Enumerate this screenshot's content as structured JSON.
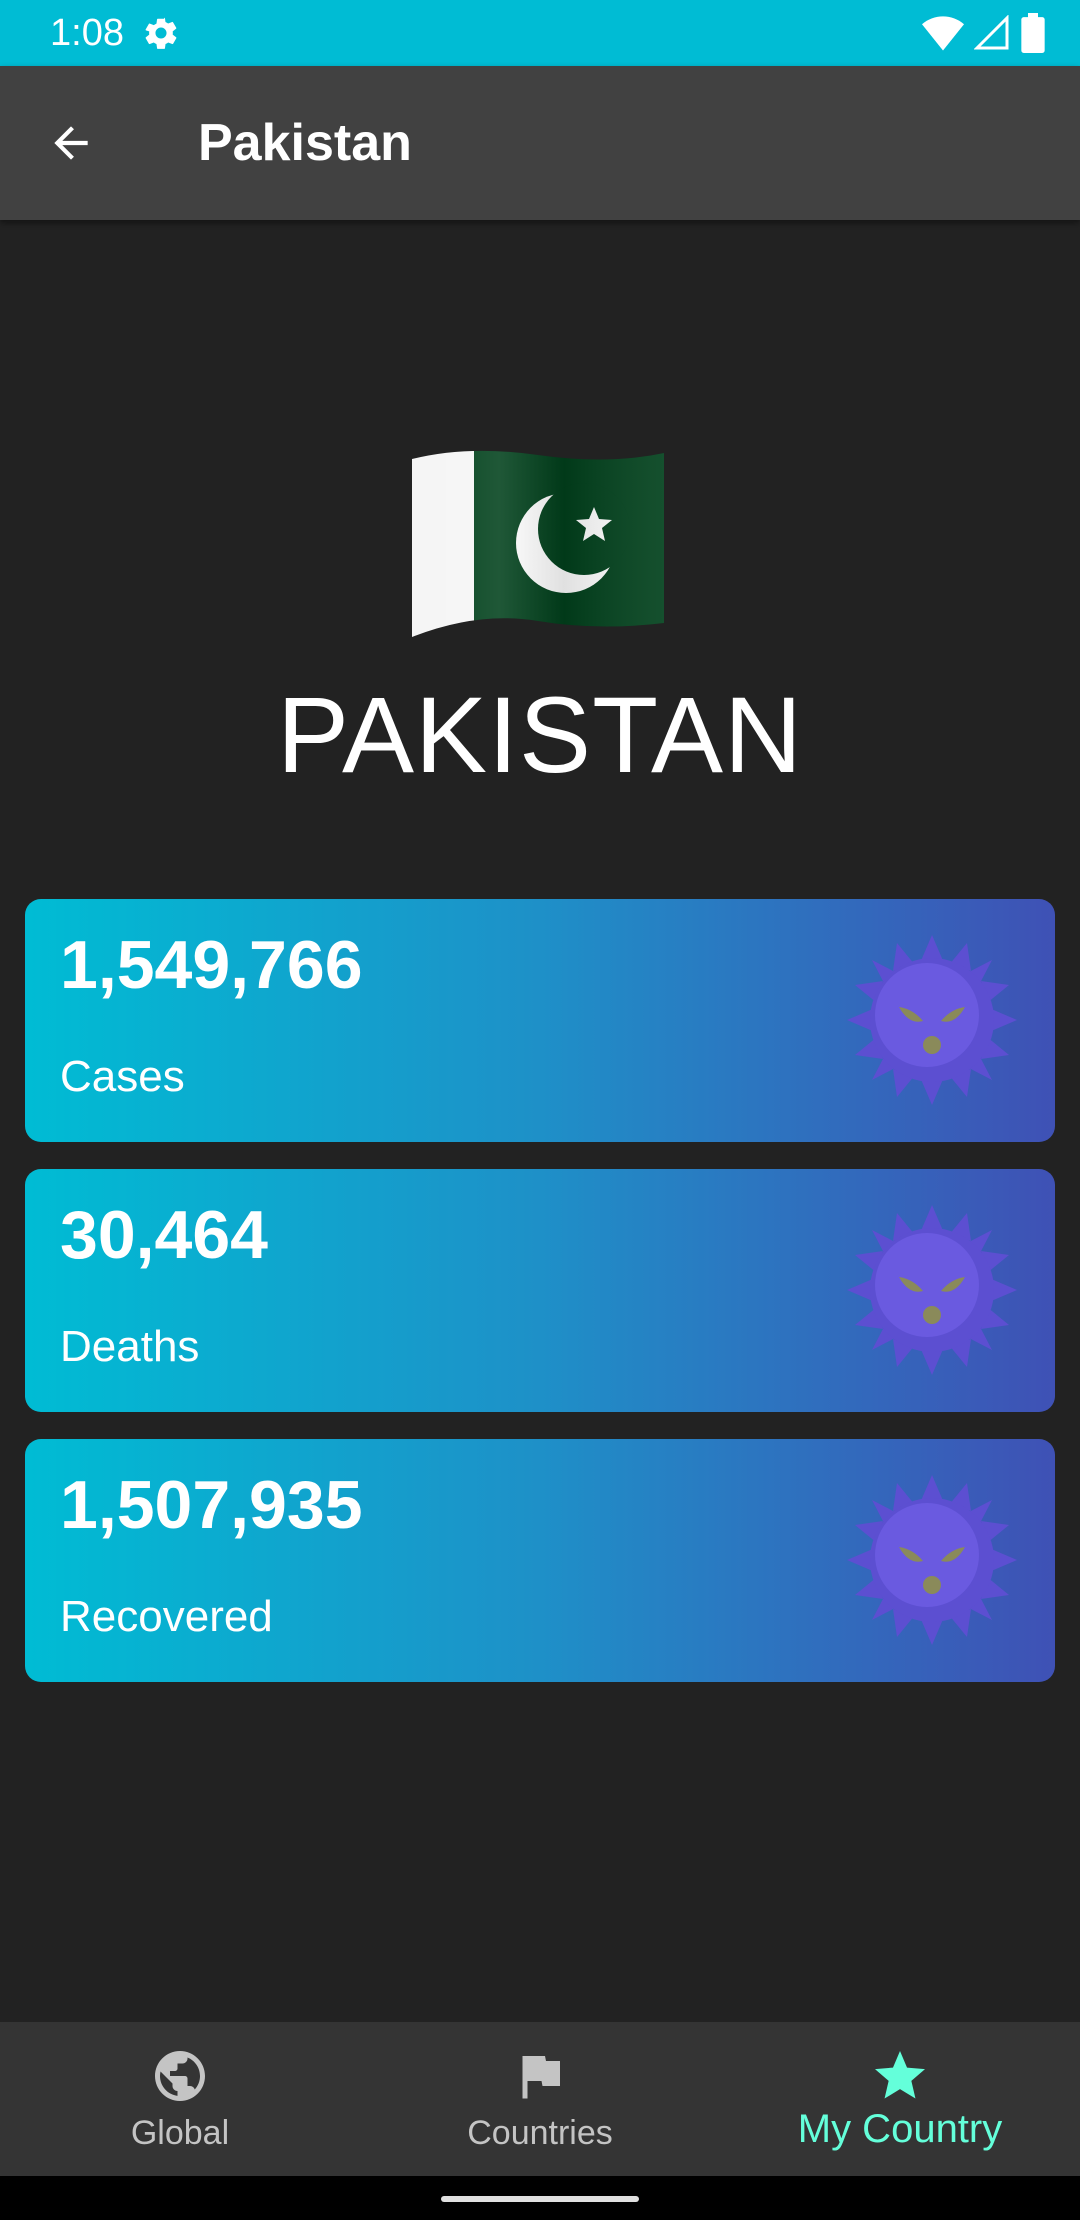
{
  "status_bar": {
    "time": "1:08",
    "background": "#00bcd4",
    "icons": [
      "settings-icon",
      "wifi-icon",
      "signal-icon",
      "battery-icon"
    ]
  },
  "app_bar": {
    "title": "Pakistan",
    "back_icon": "arrow-back-icon"
  },
  "country": {
    "name": "PAKISTAN",
    "flag_icon": "pakistan-flag-icon"
  },
  "stats": [
    {
      "value": "1,549,766",
      "label": "Cases",
      "icon": "virus-icon"
    },
    {
      "value": "30,464",
      "label": "Deaths",
      "icon": "virus-icon"
    },
    {
      "value": "1,507,935",
      "label": "Recovered",
      "icon": "virus-icon"
    }
  ],
  "card_gradient": [
    "#00bcd4",
    "#3f51b5"
  ],
  "bottom_nav": {
    "items": [
      {
        "label": "Global",
        "icon": "globe-icon",
        "active": false
      },
      {
        "label": "Countries",
        "icon": "flag-icon",
        "active": false
      },
      {
        "label": "My Country",
        "icon": "star-icon",
        "active": true
      }
    ],
    "active_color": "#64ffda",
    "inactive_color": "#c4c4c4"
  }
}
